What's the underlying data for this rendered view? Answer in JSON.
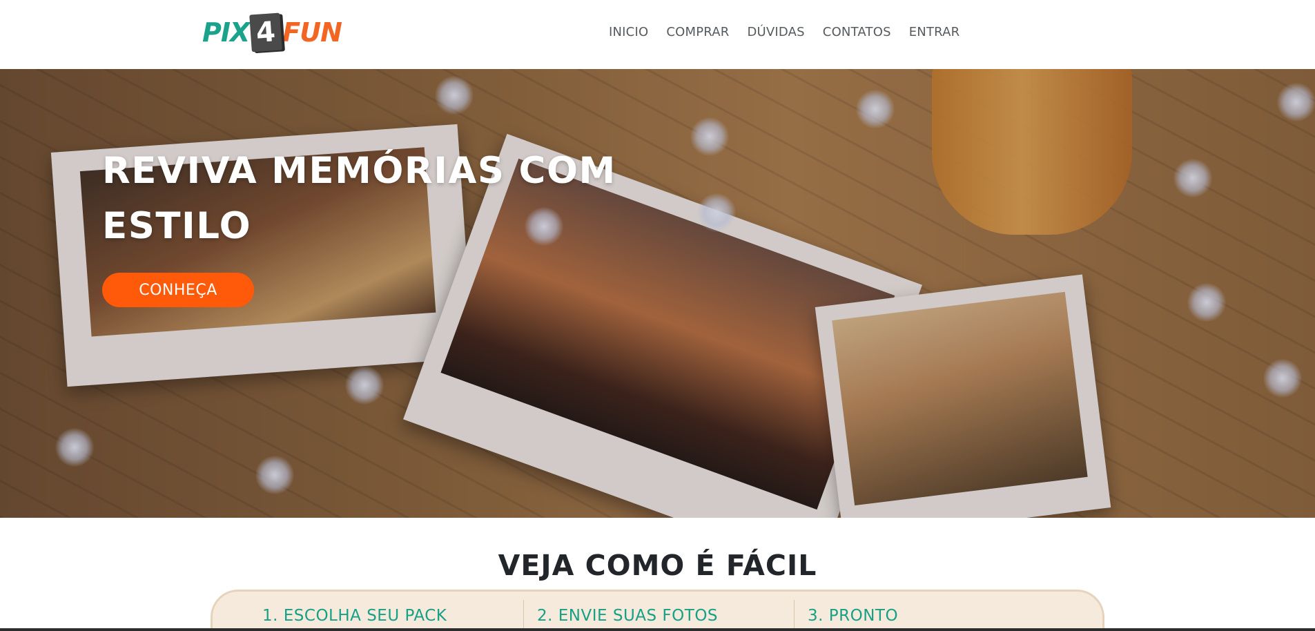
{
  "logo": {
    "pix": "PIX",
    "four": "4",
    "fun": "FUN"
  },
  "nav": {
    "items": [
      {
        "label": "INICIO"
      },
      {
        "label": "COMPRAR"
      },
      {
        "label": "DÚVIDAS"
      },
      {
        "label": "CONTATOS"
      },
      {
        "label": "ENTRAR"
      }
    ]
  },
  "hero": {
    "title_line1": "REVIVA MEMÓRIAS COM",
    "title_line2": "ESTILO",
    "button_label": "CONHEÇA"
  },
  "steps": {
    "title": "VEJA COMO É FÁCIL",
    "items": [
      {
        "label": "1. ESCOLHA SEU PACK"
      },
      {
        "label": "2. ENVIE SUAS FOTOS"
      },
      {
        "label": "3. PRONTO"
      }
    ]
  },
  "colors": {
    "brand_green": "#1aa38a",
    "brand_orange": "#f26522",
    "cta_orange": "#fe5a0a",
    "step_green": "#16a085",
    "panel_bg": "#f6eadd"
  }
}
